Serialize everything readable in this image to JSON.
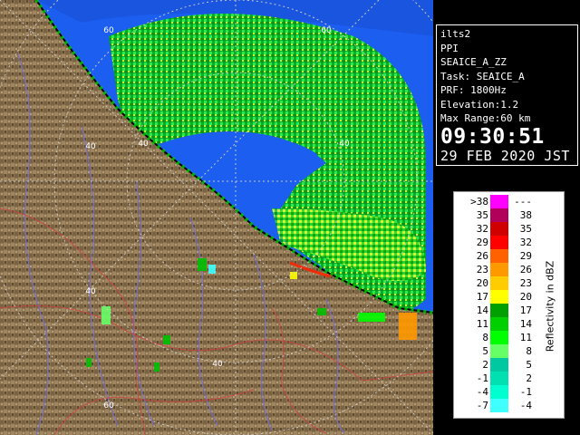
{
  "info": {
    "site": "ilts2",
    "product": "PPI",
    "scan_name": "SEAICE_A_ZZ",
    "task": "Task: SEAICE_A",
    "prf": "PRF: 1800Hz",
    "elevation": "Elevation:1.2",
    "max_range": "Max Range:60 km",
    "time": "09:30:51",
    "date": "29 FEB 2020 JST"
  },
  "range_labels": [
    "40",
    "60",
    "40",
    "60",
    "40",
    "40",
    "40",
    "60"
  ],
  "legend": {
    "title": "Reflectivity in dBZ",
    "rows": [
      {
        "lo": ">38",
        "hi": "---",
        "color": "#ff00ff"
      },
      {
        "lo": "35",
        "hi": "38",
        "color": "#b0005a"
      },
      {
        "lo": "32",
        "hi": "35",
        "color": "#d00000"
      },
      {
        "lo": "29",
        "hi": "32",
        "color": "#ff0000"
      },
      {
        "lo": "26",
        "hi": "29",
        "color": "#ff6000"
      },
      {
        "lo": "23",
        "hi": "26",
        "color": "#ff9900"
      },
      {
        "lo": "20",
        "hi": "23",
        "color": "#ffcc00"
      },
      {
        "lo": "17",
        "hi": "20",
        "color": "#ffff00"
      },
      {
        "lo": "14",
        "hi": "17",
        "color": "#00a000"
      },
      {
        "lo": "11",
        "hi": "14",
        "color": "#00d000"
      },
      {
        "lo": "8",
        "hi": "11",
        "color": "#00ff00"
      },
      {
        "lo": "5",
        "hi": "8",
        "color": "#66ff66"
      },
      {
        "lo": "2",
        "hi": "5",
        "color": "#00c8a0"
      },
      {
        "lo": "-1",
        "hi": "2",
        "color": "#00e0b0"
      },
      {
        "lo": "-4",
        "hi": "-1",
        "color": "#00ffd0"
      },
      {
        "lo": "-7",
        "hi": "-4",
        "color": "#40ffff"
      }
    ]
  },
  "colors": {
    "sea": "#1b5ef0",
    "land": "#8c7350",
    "coast_outline": "#ffffff",
    "range_ring": "#c8c8c8"
  }
}
